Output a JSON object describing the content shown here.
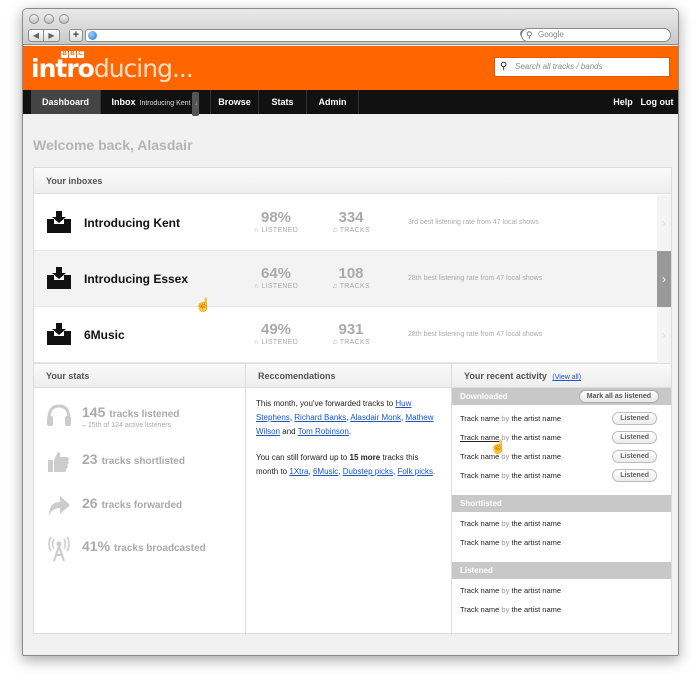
{
  "browser": {
    "search_placeholder": "Google"
  },
  "site": {
    "logo_text_bold": "intro",
    "logo_text_light": "ducing...",
    "bbc_letters": [
      "B",
      "B",
      "C"
    ],
    "search_placeholder": "Search all tracks / bands"
  },
  "nav": {
    "dashboard": "Dashboard",
    "inbox": "Inbox",
    "inbox_sub": "Introducing Kent",
    "inbox_badge": "↓",
    "browse": "Browse",
    "stats": "Stats",
    "admin": "Admin",
    "help": "Help",
    "logout": "Log out"
  },
  "welcome": "Welcome back, Alasdair",
  "inboxes": {
    "heading": "Your inboxes",
    "rows": [
      {
        "name": "Introducing Kent",
        "listened_pct": "98%",
        "listened_label": "LISTENED",
        "tracks": "334",
        "tracks_label": "TRACKS",
        "rank": "3rd best listening rate from 47 local shows"
      },
      {
        "name": "Introducing Essex",
        "listened_pct": "64%",
        "listened_label": "LISTENED",
        "tracks": "108",
        "tracks_label": "TRACKS",
        "rank": "28th best listening rate from 47 local shows"
      },
      {
        "name": "6Music",
        "listened_pct": "49%",
        "listened_label": "LISTENED",
        "tracks": "931",
        "tracks_label": "TRACKS",
        "rank": "28th best listening rate from 47 local shows"
      }
    ]
  },
  "stats": {
    "heading": "Your stats",
    "items": [
      {
        "value": "145",
        "label": "tracks listened",
        "sub": "– 15th of 124 active listeners",
        "icon": "headphones-icon"
      },
      {
        "value": "23",
        "label": "tracks shortlisted",
        "icon": "thumbs-up-icon"
      },
      {
        "value": "26",
        "label": "tracks forwarded",
        "icon": "forward-arrow-icon"
      },
      {
        "value": "41%",
        "label": "tracks broadcasted",
        "icon": "broadcast-tower-icon"
      }
    ]
  },
  "recommendations": {
    "heading": "Reccomendations",
    "p1_prefix": "This month, you've forwarded tracks to",
    "people": [
      "Huw Stephens",
      "Richard Banks",
      "Alasdair Monk",
      "Mathew Wilson",
      "Tom Robinson"
    ],
    "and": "and",
    "p2_prefix": "You can still forward up to",
    "p2_bold": "15 more",
    "p2_mid": "tracks this month to",
    "stations": [
      "1Xtra",
      "6Music",
      "Dubstep picks",
      "Folk picks"
    ]
  },
  "activity": {
    "heading": "Your recent activity",
    "view_all": "View all",
    "downloaded_label": "Downloaded",
    "mark_all": "Mark all as listened",
    "shortlisted_label": "Shortlisted",
    "listened_label": "Listened",
    "track_name": "Track name",
    "by": "by",
    "artist_name": "the artist name",
    "listened_btn": "Listened"
  }
}
